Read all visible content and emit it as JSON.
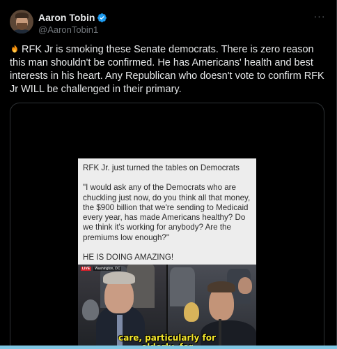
{
  "tweet": {
    "author_name": "Aaron Tobin",
    "author_handle": "@AaronTobin1",
    "verified": true,
    "more_label": "···",
    "emoji": "fire-icon",
    "text": "RFK Jr is smoking these Senate democrats. There is zero reason this man shouldn't be confirmed. He has Americans' health and best interests in his heart. Any Republican who doesn't vote to confirm RFK Jr WILL be challenged in their primary."
  },
  "media": {
    "quote_card": {
      "title": "RFK Jr. just turned the tables on Democrats",
      "body": "\"I would ask any of the Democrats who are chuckling just now, do you think all that money, the $900 billion that we're sending to Medicaid every year, has made Americans healthy? Do we think it's working for anybody? Are the premiums low enough?\"",
      "footer": "HE IS DOING AMAZING!"
    },
    "video": {
      "live_label": "LIVE",
      "location": "Washington, DC",
      "caption_line1": "care, particularly for",
      "caption_line2": "elderly, for"
    }
  },
  "colors": {
    "background": "#000000",
    "text": "#e7e9ea",
    "muted": "#71767b",
    "verified": "#1d9bf0",
    "caption": "#f5e82c",
    "live": "#d0202a"
  }
}
